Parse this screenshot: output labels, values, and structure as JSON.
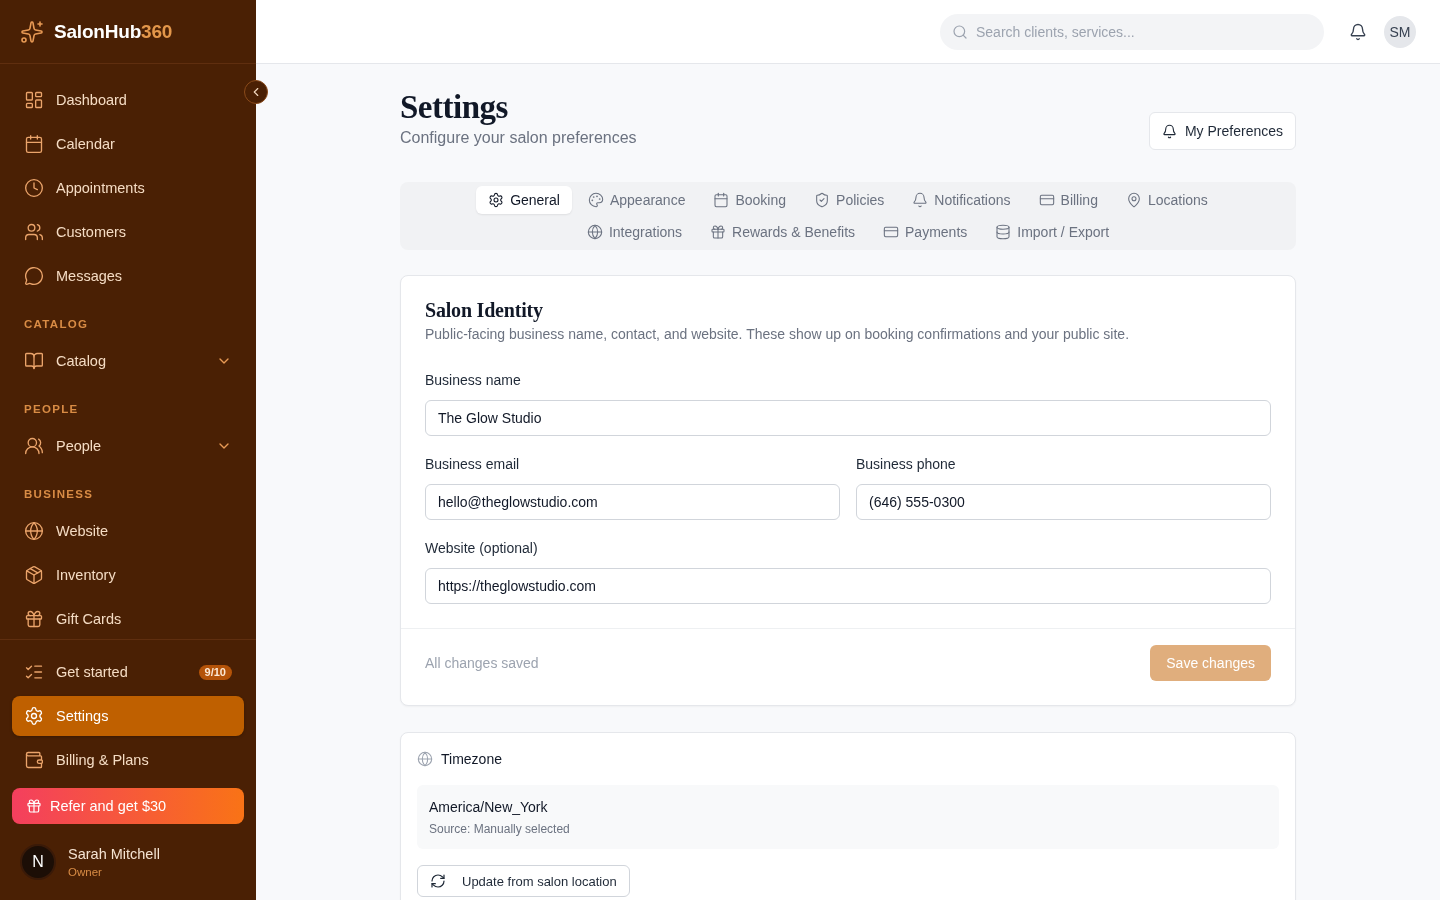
{
  "brand": {
    "name": "SalonHub",
    "suffix": "360"
  },
  "sidebar": {
    "main_items": [
      {
        "label": "Dashboard",
        "selected": false
      },
      {
        "label": "Calendar",
        "selected": false
      },
      {
        "label": "Appointments",
        "selected": false
      },
      {
        "label": "Customers",
        "selected": false
      },
      {
        "label": "Messages",
        "selected": false
      }
    ],
    "sections": [
      {
        "heading": "CATALOG",
        "items": [
          {
            "label": "Catalog",
            "selected": false,
            "expanded": false
          }
        ]
      },
      {
        "heading": "PEOPLE",
        "items": [
          {
            "label": "People",
            "selected": false,
            "expanded": false
          }
        ]
      },
      {
        "heading": "BUSINESS",
        "items": [
          {
            "label": "Website",
            "selected": false
          },
          {
            "label": "Inventory",
            "selected": false
          },
          {
            "label": "Gift Cards",
            "selected": false
          }
        ]
      }
    ],
    "footer_items": [
      {
        "label": "Get started",
        "badge": "9/10",
        "selected": false
      },
      {
        "label": "Settings",
        "selected": true
      },
      {
        "label": "Billing & Plans",
        "selected": false
      }
    ],
    "referral_button": "Refer and get $30",
    "user": {
      "avatar": "N",
      "name": "Sarah Mitchell",
      "role": "Owner"
    }
  },
  "topbar": {
    "search": {
      "placeholder": "Search clients, services..."
    },
    "avatar": "SM"
  },
  "page_header": {
    "title": "Settings",
    "subtitle": "Configure your salon preferences",
    "preferences_button": "My Preferences"
  },
  "tabs": [
    {
      "label": "General",
      "selected": true
    },
    {
      "label": "Appearance",
      "selected": false
    },
    {
      "label": "Booking",
      "selected": false
    },
    {
      "label": "Policies",
      "selected": false
    },
    {
      "label": "Notifications",
      "selected": false
    },
    {
      "label": "Billing",
      "selected": false
    },
    {
      "label": "Locations",
      "selected": false
    },
    {
      "label": "Integrations",
      "selected": false
    },
    {
      "label": "Rewards & Benefits",
      "selected": false
    },
    {
      "label": "Payments",
      "selected": false
    },
    {
      "label": "Import / Export",
      "selected": false
    }
  ],
  "identity_card": {
    "title": "Salon Identity",
    "description": "Public-facing business name, contact, and website. These show up on booking confirmations and your public site.",
    "field_rows": [
      [
        {
          "label": "Business name",
          "value": "The Glow Studio"
        }
      ],
      [
        {
          "label": "Business email",
          "value": "hello@theglowstudio.com"
        },
        {
          "label": "Business phone",
          "value": "(646) 555-0300"
        }
      ],
      [
        {
          "label": "Website (optional)",
          "value": "https://theglowstudio.com"
        }
      ]
    ],
    "status": "All changes saved",
    "save_button": {
      "label": "Save changes",
      "disabled": true
    }
  },
  "timezone_card": {
    "title": "Timezone",
    "value": "America/New_York",
    "source": "Source: Manually selected",
    "update_button": "Update from salon location"
  }
}
